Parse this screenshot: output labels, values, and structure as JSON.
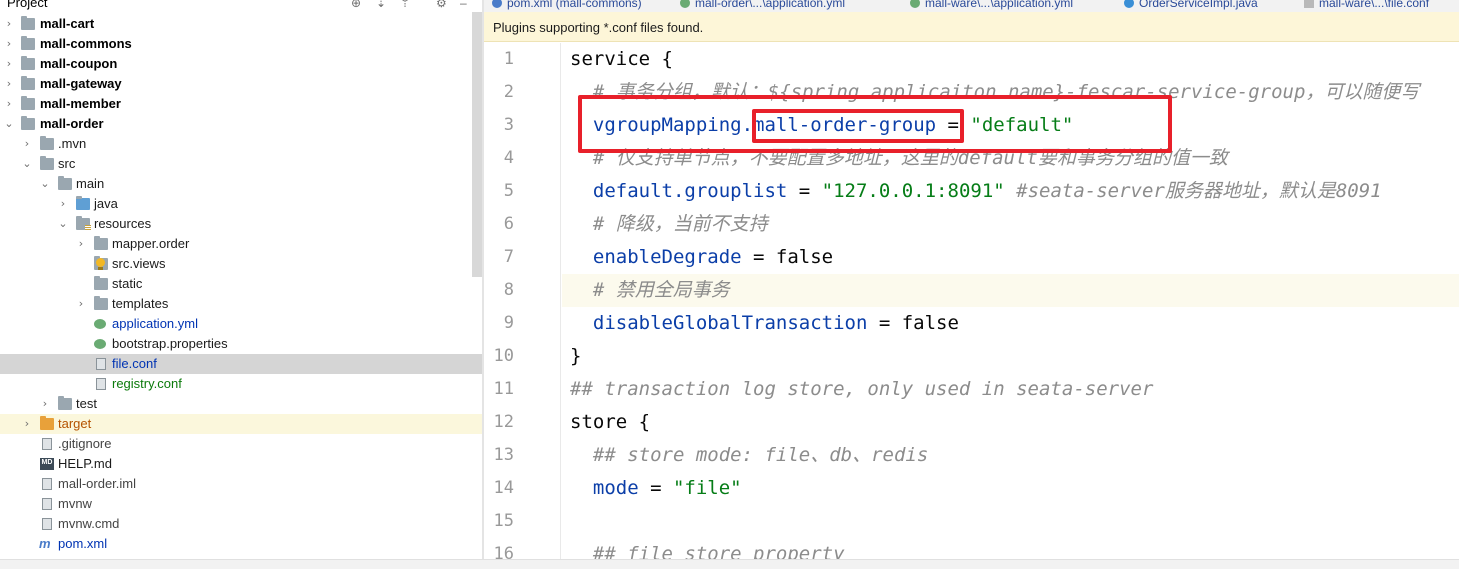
{
  "project": {
    "title": "Project",
    "items": [
      {
        "label": "mall-cart"
      },
      {
        "label": "mall-commons"
      },
      {
        "label": "mall-coupon"
      },
      {
        "label": "mall-gateway"
      },
      {
        "label": "mall-member"
      },
      {
        "label": "mall-order"
      },
      {
        "label": ".mvn"
      },
      {
        "label": "src"
      },
      {
        "label": "main"
      },
      {
        "label": "java"
      },
      {
        "label": "resources"
      },
      {
        "label": "mapper.order"
      },
      {
        "label": "src.views"
      },
      {
        "label": "static"
      },
      {
        "label": "templates"
      },
      {
        "label": "application.yml"
      },
      {
        "label": "bootstrap.properties"
      },
      {
        "label": "file.conf"
      },
      {
        "label": "registry.conf"
      },
      {
        "label": "test"
      },
      {
        "label": "target"
      },
      {
        "label": ".gitignore"
      },
      {
        "label": "HELP.md"
      },
      {
        "label": "mall-order.iml"
      },
      {
        "label": "mvnw"
      },
      {
        "label": "mvnw.cmd"
      },
      {
        "label": "pom.xml"
      }
    ]
  },
  "tabs": [
    {
      "label": "pom.xml (mall-commons)"
    },
    {
      "label": "mall-order\\...\\application.yml"
    },
    {
      "label": "mall-ware\\...\\application.yml"
    },
    {
      "label": "OrderServiceImpl.java"
    },
    {
      "label": "mall-ware\\...\\file.conf"
    }
  ],
  "notice": "Plugins supporting *.conf files found.",
  "editor": {
    "line_numbers": [
      "1",
      "2",
      "3",
      "4",
      "5",
      "6",
      "7",
      "8",
      "9",
      "10",
      "11",
      "12",
      "13",
      "14",
      "15",
      "16"
    ],
    "lines": {
      "l1": "service {",
      "l2": "  # 事务分组，默认：${spring.applicaiton.name}-fescar-service-group，可以随便写",
      "l3_key": "  vgroupMapping",
      "l3_dot": ".",
      "l3_group": "mall-order-group",
      "l3_eq": " = ",
      "l3_val": "\"default\"",
      "l4": "  # 仅支持单节点，不要配置多地址，这里的default要和事务分组的值一致",
      "l5_key": "  default.grouplist",
      "l5_eq": " = ",
      "l5_val": "\"127.0.0.1:8091\"",
      "l5_cmt": " #seata-server服务器地址，默认是8091",
      "l6": "  # 降级，当前不支持",
      "l7_key": "  enableDegrade",
      "l7_rest": " = false",
      "l8": "  # 禁用全局事务",
      "l9_key": "  disableGlobalTransaction",
      "l9_rest": " = false",
      "l10": "}",
      "l11": "## transaction log store, only used in seata-server",
      "l12": "store {",
      "l13": "  ## store mode: file、db、redis",
      "l14_key": "  mode",
      "l14_eq": " = ",
      "l14_val": "\"file\"",
      "l15": "",
      "l16": "  ## file store property"
    }
  },
  "colors": {
    "annotation": "#e8202a",
    "key": "#0b3ea8",
    "string": "#067d17",
    "comment": "#8c8c8c"
  }
}
